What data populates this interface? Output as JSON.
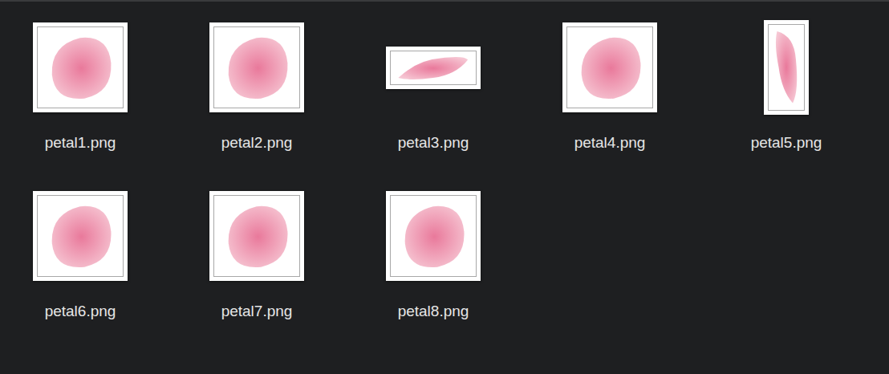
{
  "files": [
    {
      "name": "petal1.png",
      "kind": "square",
      "selected": false
    },
    {
      "name": "petal2.png",
      "kind": "square",
      "selected": false
    },
    {
      "name": "petal3.png",
      "kind": "wide",
      "selected": false
    },
    {
      "name": "petal4.png",
      "kind": "square",
      "selected": false
    },
    {
      "name": "petal5.png",
      "kind": "tall",
      "selected": false
    },
    {
      "name": "petal6.png",
      "kind": "square",
      "selected": false
    },
    {
      "name": "petal7.png",
      "kind": "square",
      "selected": false
    },
    {
      "name": "petal8.png",
      "kind": "square",
      "selected": false
    }
  ]
}
